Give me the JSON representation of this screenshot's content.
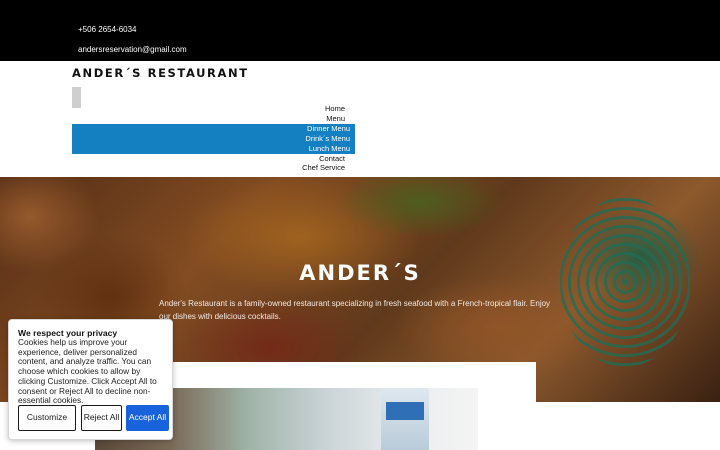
{
  "topbar": {
    "phone": "+506 2654-6034",
    "email": "andersreservation@gmail.com"
  },
  "header": {
    "brand": "ANDER´S RESTAURANT"
  },
  "nav": {
    "items": [
      {
        "label": "Home"
      },
      {
        "label": "Menu"
      },
      {
        "label": "Dinner Menu"
      },
      {
        "label": "Drink´s Menu"
      },
      {
        "label": "Lunch Menu"
      },
      {
        "label": "Contact"
      },
      {
        "label": "Chef Service"
      }
    ]
  },
  "hero": {
    "title": "ANDER´S",
    "description": "Ander's Restaurant is a family-owned restaurant specializing in fresh seafood with a French-tropical flair. Enjoy our dishes with delicious cocktails."
  },
  "cookie": {
    "title": "We respect your privacy",
    "text": "Cookies help us improve your experience, deliver personalized content, and analyze traffic. You can choose which cookies to allow by clicking Customize. Click Accept All to consent or Reject All to decline non-essential cookies.",
    "customize_label": "Customize",
    "reject_label": "Reject All",
    "accept_label": "Accept All"
  },
  "colors": {
    "topbar": "#000000",
    "submenu": "#1480c2",
    "accept_button": "#1863dc"
  }
}
